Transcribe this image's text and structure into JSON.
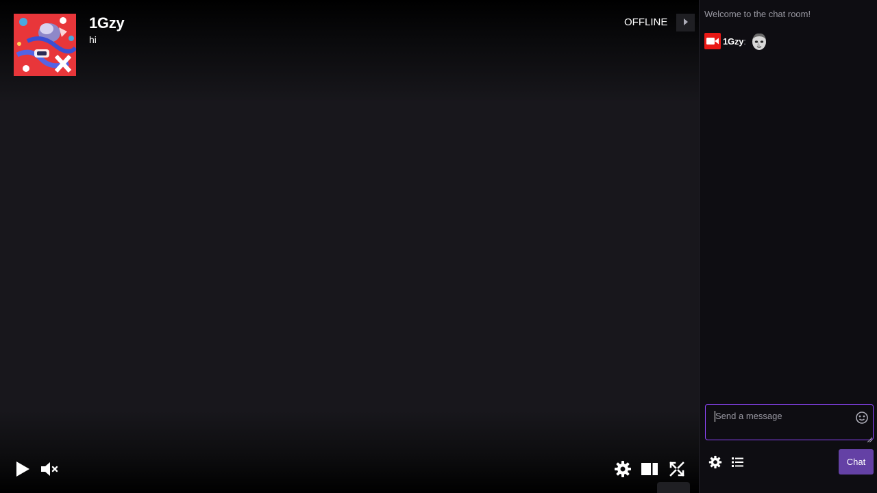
{
  "player": {
    "channel_name": "1Gzy",
    "status_text": "hi",
    "offline_label": "OFFLINE",
    "controls": {
      "play": "play-icon",
      "mute": "volume-muted-icon",
      "settings": "gear-icon",
      "theatre": "theatre-mode-icon",
      "fullscreen": "fullscreen-icon"
    }
  },
  "chat": {
    "welcome": "Welcome to the chat room!",
    "messages": [
      {
        "username": "1Gzy",
        "separator": ":",
        "badge": "broadcaster-badge",
        "emote": "face-emote"
      }
    ],
    "input": {
      "placeholder": "Send a message"
    },
    "send_label": "Chat",
    "accent": "#9147ff",
    "button_color": "#6441a5"
  }
}
